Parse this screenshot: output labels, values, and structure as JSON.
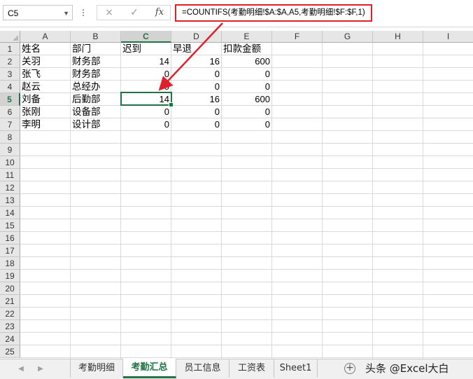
{
  "formula_bar": {
    "name_box": "C5",
    "cancel_icon": "×",
    "enter_icon": "✓",
    "function_icon": "fx",
    "formula": "=COUNTIFS(考勤明细!$A:$A,A5,考勤明细!$F:$F,1)"
  },
  "columns": [
    "A",
    "B",
    "C",
    "D",
    "E",
    "F",
    "G",
    "H",
    "I"
  ],
  "selected_column": "C",
  "rows": [
    "1",
    "2",
    "3",
    "4",
    "5",
    "6",
    "7",
    "8",
    "9",
    "10",
    "11",
    "12",
    "13",
    "14",
    "15",
    "16",
    "17",
    "18",
    "19",
    "20",
    "21",
    "22",
    "23",
    "24",
    "25"
  ],
  "selected_row": "5",
  "table": {
    "headers": [
      "姓名",
      "部门",
      "迟到",
      "早退",
      "扣款金额"
    ],
    "records": [
      {
        "name": "关羽",
        "dept": "财务部",
        "late": "14",
        "early": "16",
        "deduction": "600"
      },
      {
        "name": "张飞",
        "dept": "财务部",
        "late": "0",
        "early": "0",
        "deduction": "0"
      },
      {
        "name": "赵云",
        "dept": "总经办",
        "late": "0",
        "early": "0",
        "deduction": "0"
      },
      {
        "name": "刘备",
        "dept": "后勤部",
        "late": "14",
        "early": "16",
        "deduction": "600"
      },
      {
        "name": "张刚",
        "dept": "设备部",
        "late": "0",
        "early": "0",
        "deduction": "0"
      },
      {
        "name": "李明",
        "dept": "设计部",
        "late": "0",
        "early": "0",
        "deduction": "0"
      }
    ]
  },
  "sheet_tabs": [
    "考勤明细",
    "考勤汇总",
    "员工信息",
    "工资表",
    "Sheet1"
  ],
  "active_sheet": "考勤汇总",
  "watermark": "头条 @Excel大白",
  "colors": {
    "accent": "#217346",
    "annotation": "#e0202a"
  }
}
